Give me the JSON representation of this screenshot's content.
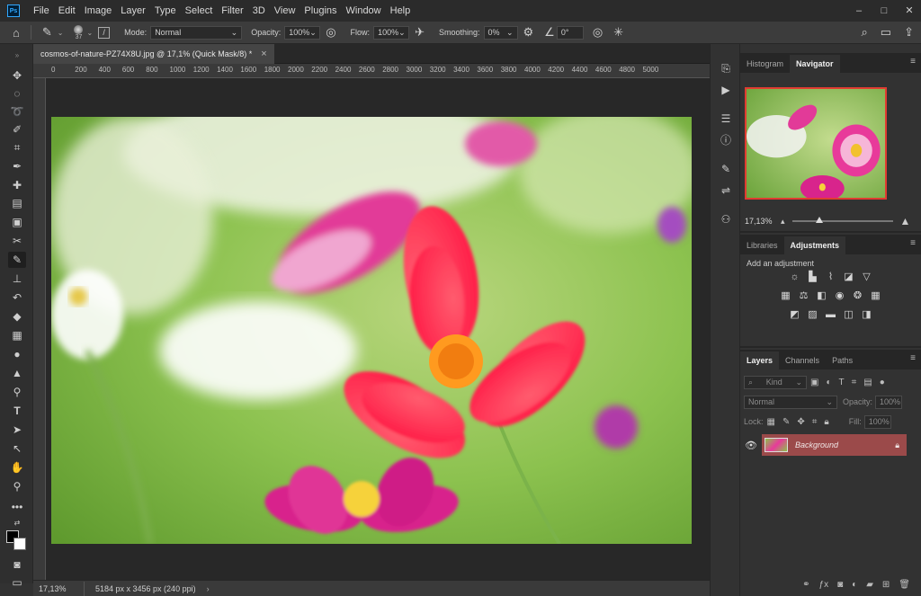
{
  "app": {
    "logo": "Ps"
  },
  "menu": [
    "File",
    "Edit",
    "Image",
    "Layer",
    "Type",
    "Select",
    "Filter",
    "3D",
    "View",
    "Plugins",
    "Window",
    "Help"
  ],
  "window_controls": {
    "minimize": "–",
    "maximize": "□",
    "close": "✕"
  },
  "options_bar": {
    "brush_size": "37",
    "mode_label": "Mode:",
    "mode_value": "Normal",
    "opacity_label": "Opacity:",
    "opacity_value": "100%",
    "flow_label": "Flow:",
    "flow_value": "100%",
    "smoothing_label": "Smoothing:",
    "smoothing_value": "0%",
    "angle_value": "0°"
  },
  "document": {
    "tab_title": "cosmos-of-nature-PZ74X8U.jpg @ 17,1% (Quick Mask/8) *",
    "tab_close": "×",
    "ruler_ticks": [
      "0",
      "200",
      "400",
      "600",
      "800",
      "1000",
      "1200",
      "1400",
      "1600",
      "1800",
      "2000",
      "2200",
      "2400",
      "2600",
      "2800",
      "3000",
      "3200",
      "3400",
      "3600",
      "3800",
      "4000",
      "4200",
      "4400",
      "4600",
      "4800",
      "5000"
    ],
    "zoom": "17,13%",
    "doc_info": "5184 px x 3456 px (240 ppi)"
  },
  "panels": {
    "histogram_tab": "Histogram",
    "navigator_tab": "Navigator",
    "navigator_zoom": "17,13%",
    "libraries_tab": "Libraries",
    "adjustments_tab": "Adjustments",
    "add_adjustment": "Add an adjustment",
    "layers_tab": "Layers",
    "channels_tab": "Channels",
    "paths_tab": "Paths",
    "kind_filter": "Kind",
    "blend_mode": "Normal",
    "opacity_label": "Opacity:",
    "opacity_value": "100%",
    "lock_label": "Lock:",
    "fill_label": "Fill:",
    "fill_value": "100%",
    "layer_name": "Background"
  },
  "colors": {
    "accent": "#31a8ff",
    "layer_selected": "#9b4a4a",
    "quickmask_tint": "#ff0000"
  }
}
